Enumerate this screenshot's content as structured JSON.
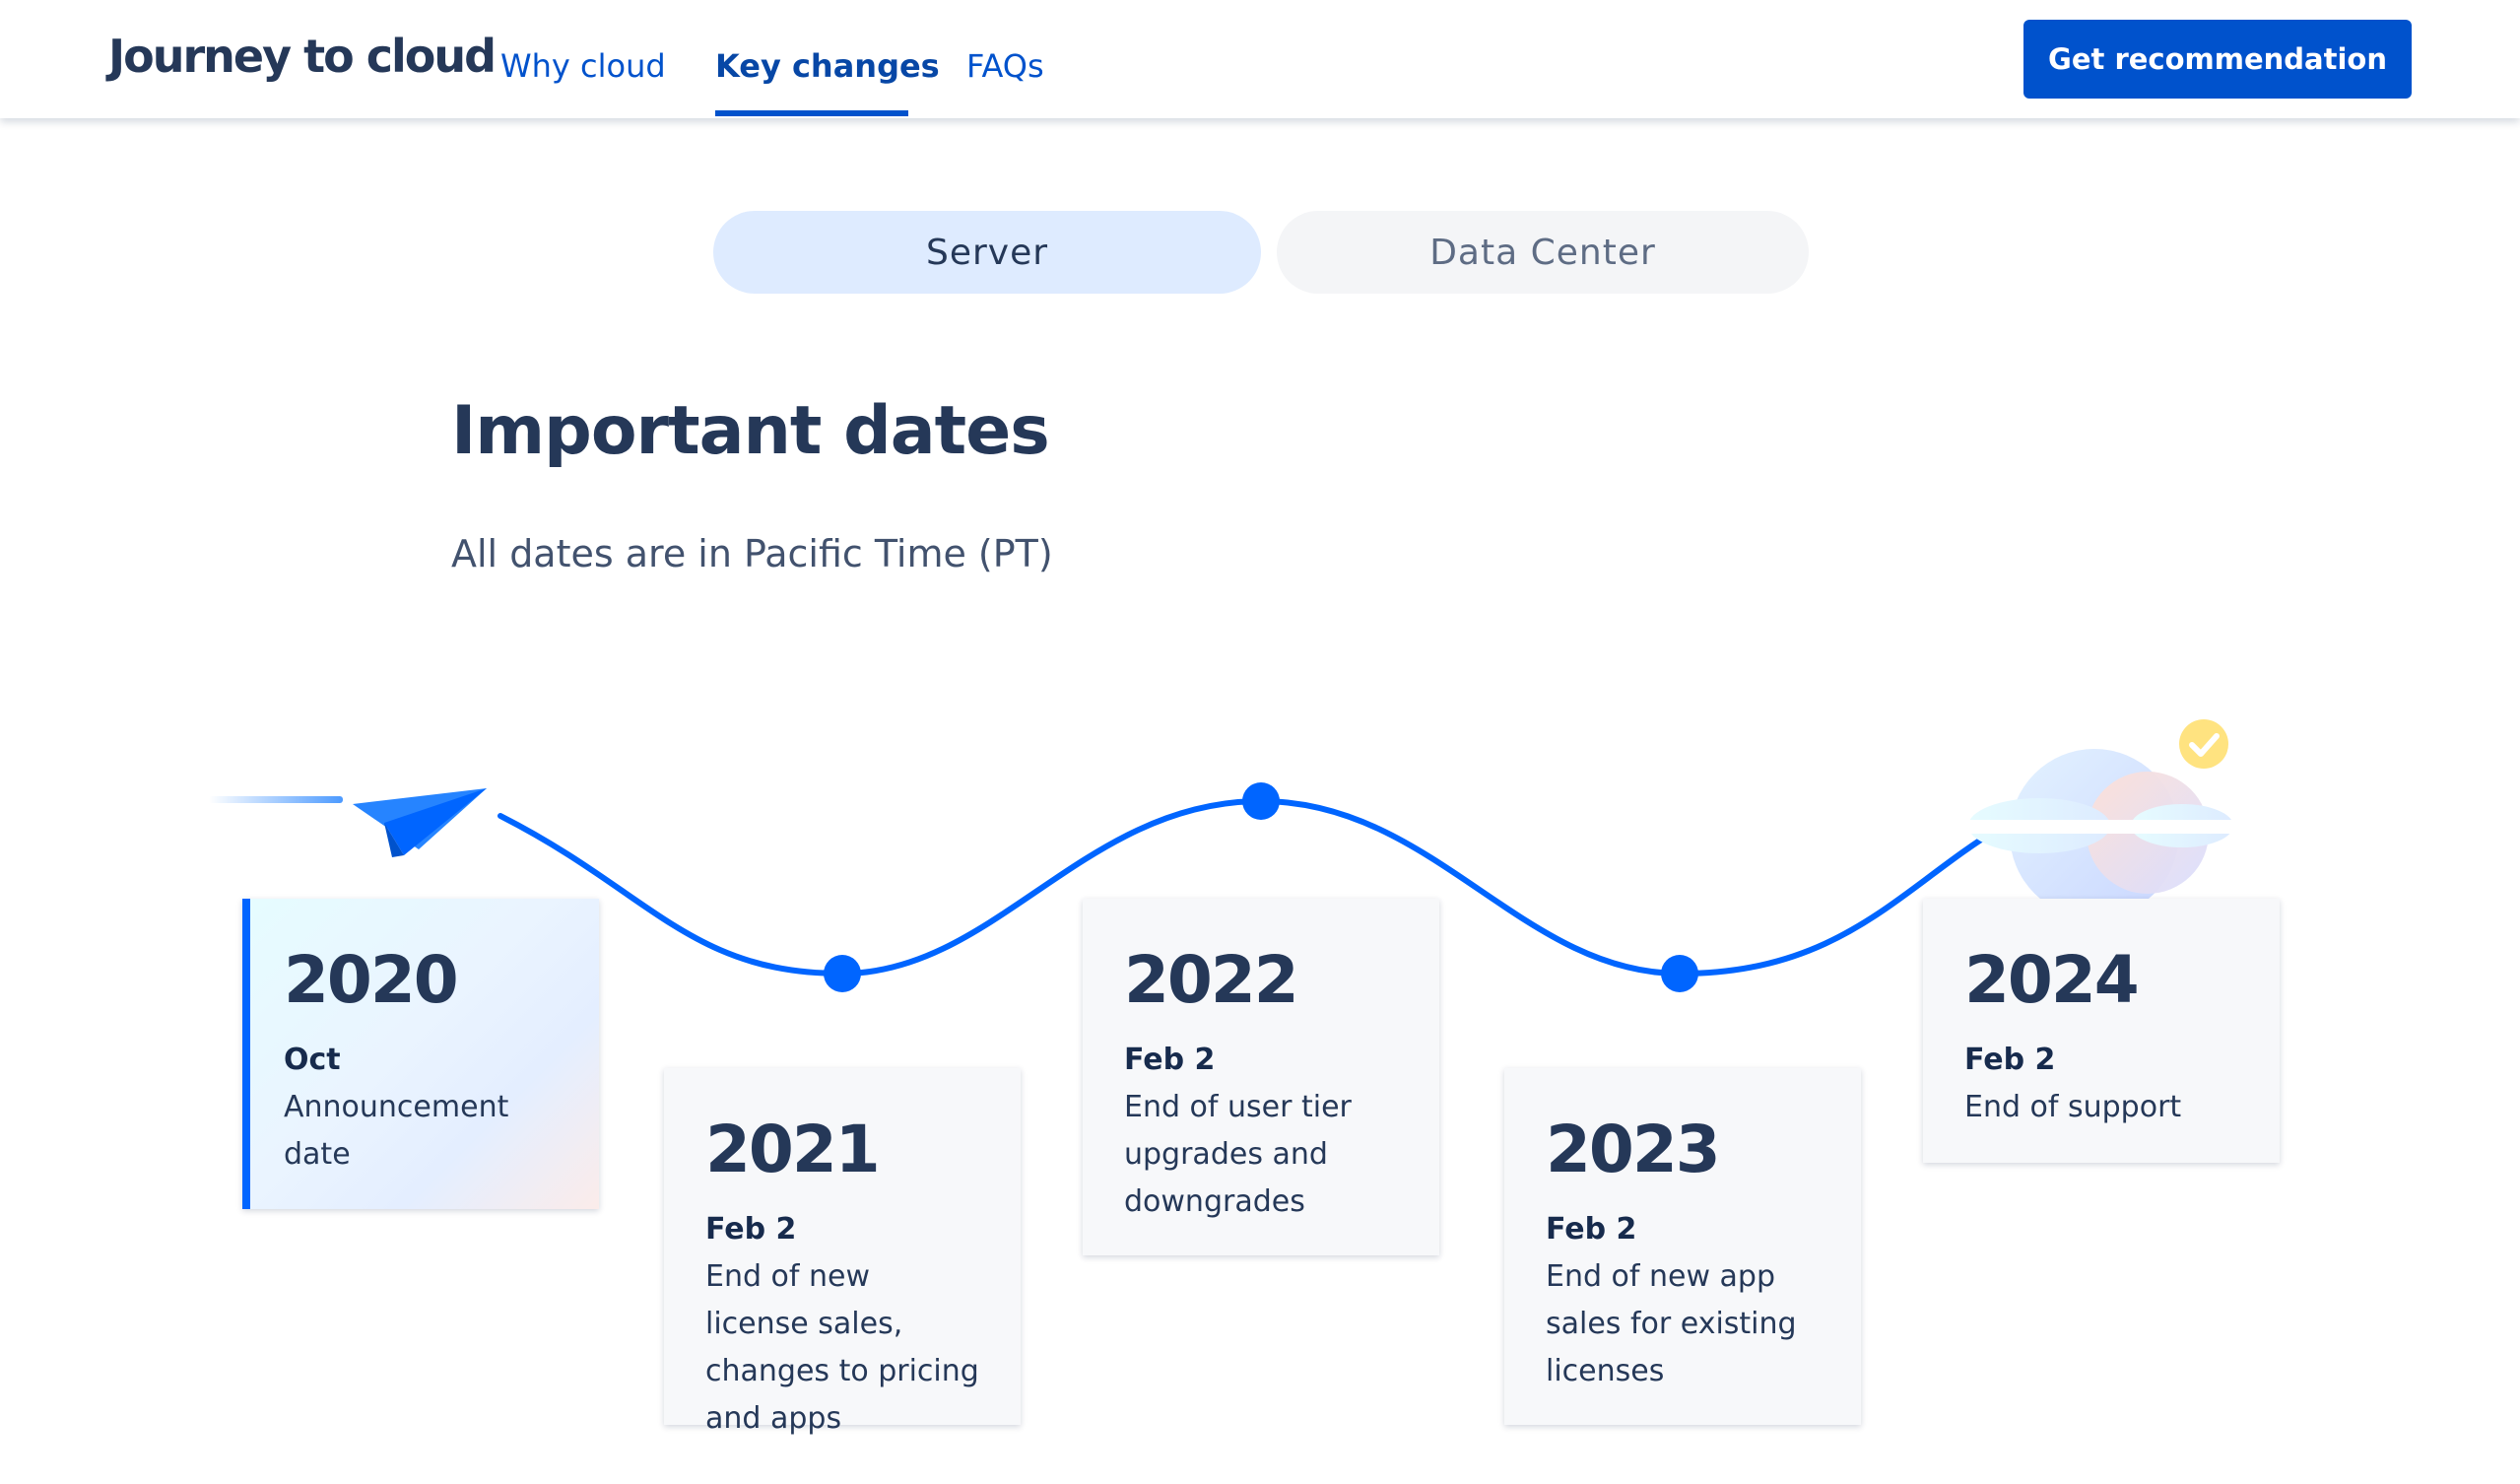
{
  "header": {
    "brand": "Journey to cloud",
    "nav": [
      {
        "label": "Why cloud"
      },
      {
        "label": "Key changes",
        "active": true
      },
      {
        "label": "FAQs"
      }
    ],
    "cta_label": "Get recommendation"
  },
  "toggle": {
    "options": [
      {
        "label": "Server",
        "selected": true
      },
      {
        "label": "Data Center",
        "selected": false
      }
    ]
  },
  "main": {
    "title": "Important dates",
    "subtitle": "All dates are in Pacific Time (PT)"
  },
  "timeline": [
    {
      "year": "2020",
      "date": "Oct",
      "description": "Announcement date"
    },
    {
      "year": "2021",
      "date": "Feb 2",
      "description": "End of new license sales, changes to pricing and apps"
    },
    {
      "year": "2022",
      "date": "Feb 2",
      "description": "End of user tier upgrades and downgrades"
    },
    {
      "year": "2023",
      "date": "Feb 2",
      "description": "End of new app sales for existing licenses"
    },
    {
      "year": "2024",
      "date": "Feb 2",
      "description": "End of support"
    }
  ],
  "icons": {
    "start": "paper-plane-icon",
    "end": "cloud-icon",
    "check": "checkmark-badge-icon"
  },
  "colors": {
    "primary": "#0052CC",
    "timeline_line": "#0065FF",
    "heading": "#253858",
    "toggle_selected_bg": "#DEEBFF",
    "toggle_unselected_bg": "#F4F5F7",
    "check_badge": "#FFE380"
  }
}
